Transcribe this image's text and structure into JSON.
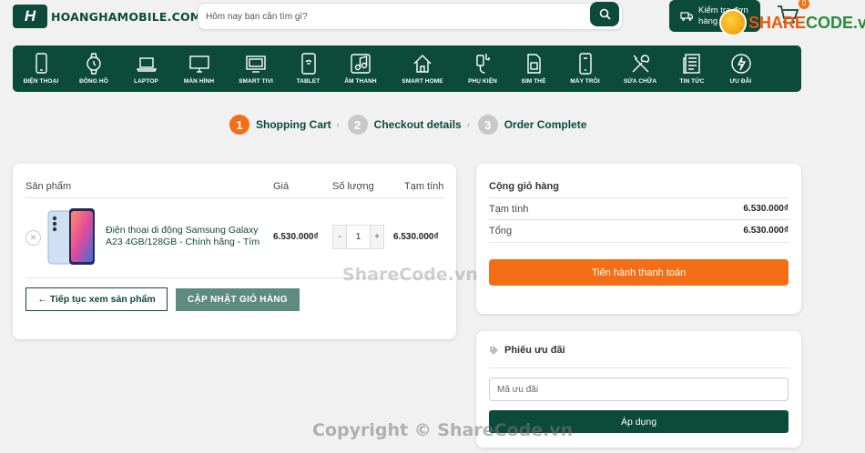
{
  "header": {
    "logo_mark": "H",
    "logo_text": "HOANGHAMOBILE.COM",
    "search_placeholder": "Hôm nay bạn cần tìm gì?",
    "check_order_label": "Kiểm tra đơn hàng",
    "cart_count": "0"
  },
  "watermark_logo": {
    "prefix": "SHARE",
    "suffix": "CODE.vn"
  },
  "nav": [
    {
      "label": "ĐIỆN THOẠI",
      "icon": "phone-icon"
    },
    {
      "label": "ĐỒNG HỒ",
      "icon": "watch-icon"
    },
    {
      "label": "LAPTOP",
      "icon": "laptop-icon"
    },
    {
      "label": "MÀN HÌNH",
      "icon": "monitor-icon"
    },
    {
      "label": "SMART TIVI",
      "icon": "tv-icon"
    },
    {
      "label": "TABLET",
      "icon": "tablet-icon"
    },
    {
      "label": "ÂM THANH",
      "icon": "music-icon"
    },
    {
      "label": "SMART HOME",
      "icon": "home-icon"
    },
    {
      "label": "PHỤ KIỆN",
      "icon": "accessory-icon"
    },
    {
      "label": "SIM THẺ",
      "icon": "sim-icon"
    },
    {
      "label": "MÁY TRÔI",
      "icon": "used-phone-icon"
    },
    {
      "label": "SỬA CHỮA",
      "icon": "tools-icon"
    },
    {
      "label": "TIN TỨC",
      "icon": "news-icon"
    },
    {
      "label": "ƯU ĐÃI",
      "icon": "lightning-icon"
    }
  ],
  "steps": [
    {
      "num": "1",
      "label": "Shopping Cart"
    },
    {
      "num": "2",
      "label": "Checkout details"
    },
    {
      "num": "3",
      "label": "Order Complete"
    }
  ],
  "cart": {
    "col_product": "Sản phẩm",
    "col_price": "Giá",
    "col_qty": "Số lượng",
    "col_subtotal": "Tạm tính",
    "item": {
      "name": "Điện thoại di động Samsung Galaxy A23 4GB/128GB - Chính hãng - Tím",
      "price": "6.530.000₫",
      "qty": "1",
      "subtotal": "6.530.000₫"
    },
    "continue_label": "← Tiếp tục xem sản phẩm",
    "update_label": "CẬP NHẬT GIỎ HÀNG"
  },
  "totals": {
    "title": "Cộng giỏ hàng",
    "subtotal_label": "Tạm tính",
    "subtotal_value": "6.530.000₫",
    "total_label": "Tổng",
    "total_value": "6.530.000₫",
    "checkout_label": "Tiến hành thanh toán"
  },
  "coupon": {
    "title": "Phiếu ưu đãi",
    "placeholder": "Mã ưu đãi",
    "apply_label": "Áp dụng"
  },
  "watermarks": {
    "center": "ShareCode.vn",
    "bottom": "Copyright © ShareCode.vn"
  },
  "colors": {
    "primary": "#0c4a3a",
    "accent": "#f36e14",
    "update_btn": "#5d8b7e"
  }
}
